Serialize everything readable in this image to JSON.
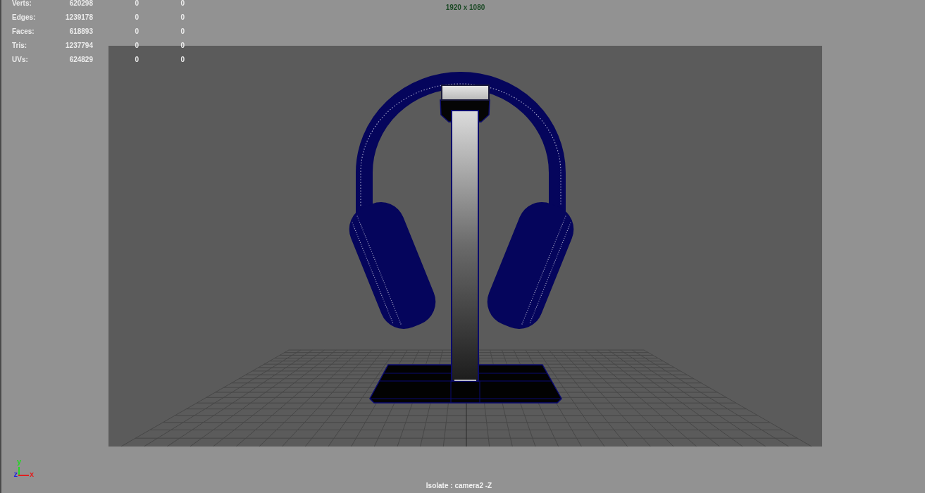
{
  "resolution_gate": {
    "label": "1920 x 1080"
  },
  "stats": [
    {
      "label": "Verts:",
      "value": "620298",
      "column_3": "0",
      "column_4": "0"
    },
    {
      "label": "Edges:",
      "value": "1239178",
      "column_3": "0",
      "column_4": "0"
    },
    {
      "label": "Faces:",
      "value": "618893",
      "column_3": "0",
      "column_4": "0"
    },
    {
      "label": "Tris:",
      "value": "1237794",
      "column_3": "0",
      "column_4": "0"
    },
    {
      "label": "UVs:",
      "value": "624829",
      "column_3": "0",
      "column_4": "0"
    }
  ],
  "axes": [
    {
      "kind": "vertical",
      "label": "y",
      "color": "#22d822"
    },
    {
      "kind": "depth",
      "label": "z",
      "color": "#2020e0"
    },
    {
      "kind": "horizontal",
      "label": "x",
      "color": "#e02020"
    }
  ],
  "status": {
    "isolate_label": "Isolate : camera2 -Z"
  }
}
